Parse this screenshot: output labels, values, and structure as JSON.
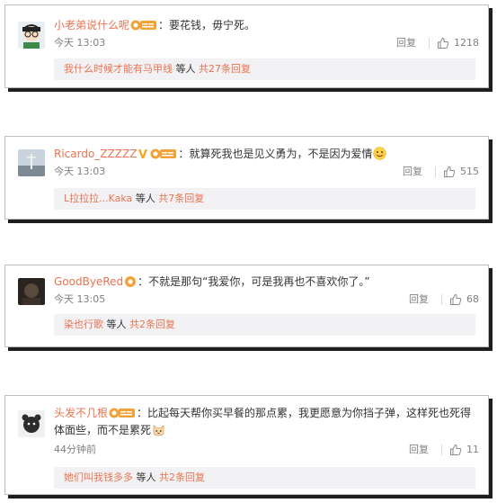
{
  "comments": [
    {
      "username": "小老弟说什么呢",
      "text": "要花钱，毋宁死。",
      "time": "今天 13:03",
      "reply_label": "回复",
      "likes": "1218",
      "sub": {
        "people": "我什么时候才能有马甲线",
        "others": "等人",
        "total": "共27条回复"
      }
    },
    {
      "username": "Ricardo_ZZZZZ",
      "text": "就算死我也是见义勇为，不是因为爱情",
      "time": "今天 13:03",
      "reply_label": "回复",
      "likes": "515",
      "sub": {
        "people": "L拉拉拉...Kaka",
        "others": "等人",
        "total": "共7条回复"
      }
    },
    {
      "username": "GoodByeRed",
      "text": "不就是那句“我爱你，可是我再也不喜欢你了。”",
      "time": "今天 13:05",
      "reply_label": "回复",
      "likes": "68",
      "sub": {
        "people": "染也行歌",
        "others": "等人",
        "total": "共2条回复"
      }
    },
    {
      "username": "头发不几根",
      "text": "比起每天帮你买早餐的那点累，我更愿意为你挡子弹，这样死也死得体面些，而不是累死",
      "time": "44分钟前",
      "reply_label": "回复",
      "likes": "11",
      "sub": {
        "people": "她们叫我钱多多",
        "others": "等人",
        "total": "共2条回复"
      }
    }
  ],
  "colors": {
    "link": "#eb7350",
    "text": "#333333",
    "muted": "#808080",
    "sub_bg": "#f2f2f5",
    "badge": "#f3a23a",
    "vip": "#f5a623"
  },
  "icons": [
    "avatar",
    "fan-badge-icon",
    "vip-v-icon",
    "thumbs-up-icon",
    "smiley-emoji-icon",
    "cat-emoji-icon"
  ]
}
